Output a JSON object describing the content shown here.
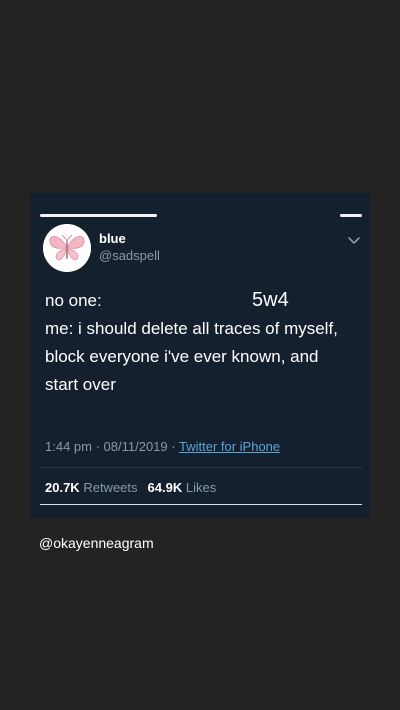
{
  "tweet": {
    "display_name": "blue",
    "handle": "@sadspell",
    "body_lines": [
      "no one:",
      "me: i should delete all traces of myself,",
      "block everyone i've ever known, and",
      "start over"
    ],
    "overlay_text": "5w4",
    "time": "1:44 pm",
    "date": "08/11/2019",
    "separator": " · ",
    "source": "Twitter for iPhone",
    "retweets_count": "20.7K",
    "retweets_label": "Retweets",
    "likes_count": "64.9K",
    "likes_label": "Likes",
    "avatar_icon": "butterfly-icon",
    "menu_icon": "chevron-down-icon"
  },
  "caption": "@okayenneagram",
  "colors": {
    "background": "#232323",
    "card": "#15202e",
    "secondary_text": "#8899a6",
    "link": "#5ba4d9",
    "butterfly": "#f4b6c2"
  }
}
